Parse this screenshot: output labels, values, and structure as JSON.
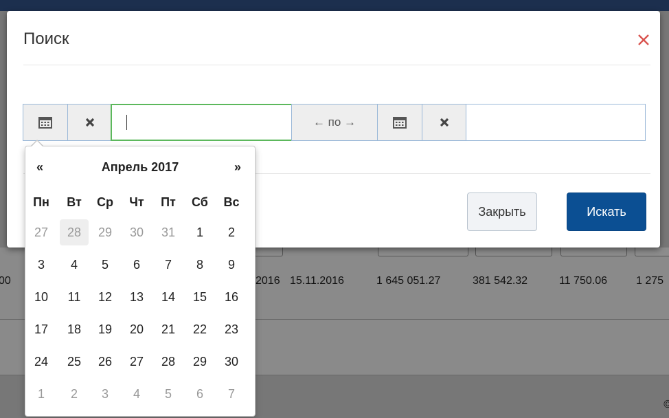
{
  "background": {
    "row_values": [
      "00",
      "2016",
      "15.11.2016",
      "1 645 051.27",
      "381 542.32",
      "11 750.06",
      "1 275"
    ],
    "copyright": "©"
  },
  "modal": {
    "title": "Поиск",
    "close_icon": "close-icon",
    "separator_label": "← по →",
    "from_value": "",
    "to_value": "",
    "buttons": {
      "close": "Закрыть",
      "search": "Искать"
    }
  },
  "datepicker": {
    "prev": "«",
    "next": "»",
    "month_label": "Апрель 2017",
    "weekdays": [
      "Пн",
      "Вт",
      "Ср",
      "Чт",
      "Пт",
      "Сб",
      "Вс"
    ],
    "weeks": [
      [
        "27",
        "28",
        "29",
        "30",
        "31",
        "1",
        "2"
      ],
      [
        "3",
        "4",
        "5",
        "6",
        "7",
        "8",
        "9"
      ],
      [
        "10",
        "11",
        "12",
        "13",
        "14",
        "15",
        "16"
      ],
      [
        "17",
        "18",
        "19",
        "20",
        "21",
        "22",
        "23"
      ],
      [
        "24",
        "25",
        "26",
        "27",
        "28",
        "29",
        "30"
      ],
      [
        "1",
        "2",
        "3",
        "4",
        "5",
        "6",
        "7"
      ]
    ],
    "muted_days": [
      [
        0,
        0
      ],
      [
        0,
        1
      ],
      [
        0,
        2
      ],
      [
        0,
        3
      ],
      [
        0,
        4
      ],
      [
        5,
        0
      ],
      [
        5,
        1
      ],
      [
        5,
        2
      ],
      [
        5,
        3
      ],
      [
        5,
        4
      ],
      [
        5,
        5
      ],
      [
        5,
        6
      ]
    ],
    "highlighted_day": [
      0,
      1
    ]
  },
  "colors": {
    "accent": "#0b4f93",
    "danger": "#d9534f",
    "focus": "#5cb85c"
  }
}
